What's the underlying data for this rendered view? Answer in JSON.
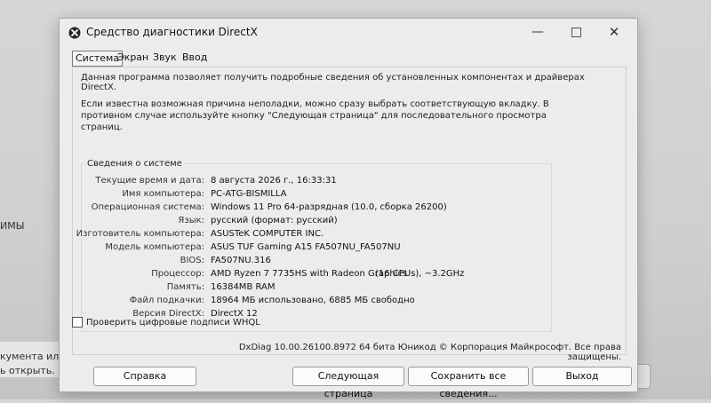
{
  "background": {
    "snippets": [
      "ИМЫ",
      "кумента или",
      "ь открыть."
    ]
  },
  "window": {
    "title": "Средство диагностики DirectX",
    "controls": {
      "minimize": "—",
      "close": "✕"
    }
  },
  "tabs": [
    "Система",
    "Экран",
    "Звук",
    "Ввод"
  ],
  "intro": "Данная программа позволяет получить подробные сведения об установленных компонентах и драйверах DirectX.",
  "intro2": "Если известна возможная причина неполадки, можно сразу выбрать соответствующую вкладку. В противном случае используйте кнопку \"Следующая страница\" для последовательного просмотра страниц.",
  "group_title": "Сведения о системе",
  "system_info": [
    {
      "label": "Текущие время и дата:",
      "value": "8 августа 2026 г., 16:33:31"
    },
    {
      "label": "Имя компьютера:",
      "value": "PC-ATG-BISMILLA"
    },
    {
      "label": "Операционная система:",
      "value": "Windows 11 Pro 64-разрядная (10.0, сборка 26200)"
    },
    {
      "label": "Язык:",
      "value": "русский (формат: русский)"
    },
    {
      "label": "Изготовитель компьютера:",
      "value": "ASUSTeK COMPUTER INC."
    },
    {
      "label": "Модель компьютера:",
      "value": "ASUS TUF Gaming A15 FA507NU_FA507NU"
    },
    {
      "label": "BIOS:",
      "value": "FA507NU.316"
    },
    {
      "label": "Процессор:",
      "value": "AMD Ryzen 7 7735HS with Radeon Graphics",
      "value2": "(16 CPUs), ~3.2GHz"
    },
    {
      "label": "Память:",
      "value": "16384MB RAM"
    },
    {
      "label": "Файл подкачки:",
      "value": "18964 МБ использовано, 6885 МБ свободно"
    },
    {
      "label": "Версия DirectX:",
      "value": "DirectX 12"
    }
  ],
  "checkbox_label": "Проверить цифровые подписи WHQL",
  "copyright": "DxDiag 10.00.26100.8972 64 бита Юникод © Корпорация Майкрософт. Все права защищены.",
  "buttons": {
    "help": "Справка",
    "next": "Следующая страница",
    "save": "Сохранить все сведения...",
    "exit": "Выход"
  }
}
